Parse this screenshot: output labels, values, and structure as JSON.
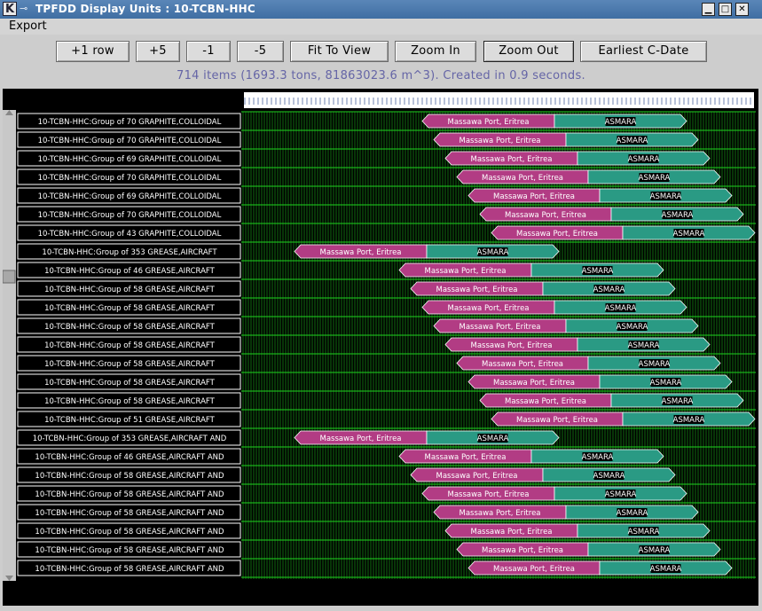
{
  "window": {
    "title": "TPFDD Display Units : 10-TCBN-HHC"
  },
  "menu": {
    "export": "Export"
  },
  "toolbar": {
    "plus_one_row": "+1 row",
    "plus_five": "+5",
    "minus_one": "-1",
    "minus_five": "-5",
    "fit_to_view": "Fit To View",
    "zoom_in": "Zoom In",
    "zoom_out": "Zoom Out",
    "earliest_cdate": "Earliest C-Date"
  },
  "status_text": "714 items (1693.3 tons, 81863023.6 m^3). Created in 0.9 seconds.",
  "colors": {
    "grid": "#1fd21f",
    "origin_segment": "#b23c84",
    "destination_segment": "#2a9a84",
    "label_bg": "#000000",
    "status_text": "#6565a6"
  },
  "chart_data": {
    "type": "gantt",
    "rows": [
      {
        "label": "10-TCBN-HHC:Group of 70 GRAPHITE,COLLOIDAL",
        "origin": "Massawa Port, Eritrea",
        "destination": "ASMARA",
        "start": 476,
        "split": 625,
        "end": 774
      },
      {
        "label": "10-TCBN-HHC:Group of 70 GRAPHITE,COLLOIDAL",
        "origin": "Massawa Port, Eritrea",
        "destination": "ASMARA",
        "start": 489,
        "split": 638,
        "end": 787
      },
      {
        "label": "10-TCBN-HHC:Group of 69 GRAPHITE,COLLOIDAL",
        "origin": "Massawa Port, Eritrea",
        "destination": "ASMARA",
        "start": 502,
        "split": 651,
        "end": 800
      },
      {
        "label": "10-TCBN-HHC:Group of 70 GRAPHITE,COLLOIDAL",
        "origin": "Massawa Port, Eritrea",
        "destination": "ASMARA",
        "start": 515,
        "split": 663,
        "end": 812
      },
      {
        "label": "10-TCBN-HHC:Group of 69 GRAPHITE,COLLOIDAL",
        "origin": "Massawa Port, Eritrea",
        "destination": "ASMARA",
        "start": 528,
        "split": 676,
        "end": 825
      },
      {
        "label": "10-TCBN-HHC:Group of 70 GRAPHITE,COLLOIDAL",
        "origin": "Massawa Port, Eritrea",
        "destination": "ASMARA",
        "start": 541,
        "split": 689,
        "end": 838
      },
      {
        "label": "10-TCBN-HHC:Group of 43 GRAPHITE,COLLOIDAL",
        "origin": "Massawa Port, Eritrea",
        "destination": "ASMARA",
        "start": 554,
        "split": 702,
        "end": 851
      },
      {
        "label": "10-TCBN-HHC:Group of 353 GREASE,AIRCRAFT",
        "origin": "Massawa Port, Eritrea",
        "destination": "ASMARA",
        "start": 332,
        "split": 481,
        "end": 630
      },
      {
        "label": "10-TCBN-HHC:Group of 46 GREASE,AIRCRAFT",
        "origin": "Massawa Port, Eritrea",
        "destination": "ASMARA",
        "start": 450,
        "split": 599,
        "end": 748
      },
      {
        "label": "10-TCBN-HHC:Group of 58 GREASE,AIRCRAFT",
        "origin": "Massawa Port, Eritrea",
        "destination": "ASMARA",
        "start": 463,
        "split": 612,
        "end": 761
      },
      {
        "label": "10-TCBN-HHC:Group of 58 GREASE,AIRCRAFT",
        "origin": "Massawa Port, Eritrea",
        "destination": "ASMARA",
        "start": 476,
        "split": 625,
        "end": 774
      },
      {
        "label": "10-TCBN-HHC:Group of 58 GREASE,AIRCRAFT",
        "origin": "Massawa Port, Eritrea",
        "destination": "ASMARA",
        "start": 489,
        "split": 638,
        "end": 787
      },
      {
        "label": "10-TCBN-HHC:Group of 58 GREASE,AIRCRAFT",
        "origin": "Massawa Port, Eritrea",
        "destination": "ASMARA",
        "start": 502,
        "split": 651,
        "end": 800
      },
      {
        "label": "10-TCBN-HHC:Group of 58 GREASE,AIRCRAFT",
        "origin": "Massawa Port, Eritrea",
        "destination": "ASMARA",
        "start": 515,
        "split": 663,
        "end": 812
      },
      {
        "label": "10-TCBN-HHC:Group of 58 GREASE,AIRCRAFT",
        "origin": "Massawa Port, Eritrea",
        "destination": "ASMARA",
        "start": 528,
        "split": 676,
        "end": 825
      },
      {
        "label": "10-TCBN-HHC:Group of 58 GREASE,AIRCRAFT",
        "origin": "Massawa Port, Eritrea",
        "destination": "ASMARA",
        "start": 541,
        "split": 689,
        "end": 838
      },
      {
        "label": "10-TCBN-HHC:Group of 51 GREASE,AIRCRAFT",
        "origin": "Massawa Port, Eritrea",
        "destination": "ASMARA",
        "start": 554,
        "split": 702,
        "end": 851
      },
      {
        "label": "10-TCBN-HHC:Group of 353 GREASE,AIRCRAFT AND",
        "origin": "Massawa Port, Eritrea",
        "destination": "ASMARA",
        "start": 332,
        "split": 481,
        "end": 630
      },
      {
        "label": "10-TCBN-HHC:Group of 46 GREASE,AIRCRAFT AND",
        "origin": "Massawa Port, Eritrea",
        "destination": "ASMARA",
        "start": 450,
        "split": 599,
        "end": 748
      },
      {
        "label": "10-TCBN-HHC:Group of 58 GREASE,AIRCRAFT AND",
        "origin": "Massawa Port, Eritrea",
        "destination": "ASMARA",
        "start": 463,
        "split": 612,
        "end": 761
      },
      {
        "label": "10-TCBN-HHC:Group of 58 GREASE,AIRCRAFT AND",
        "origin": "Massawa Port, Eritrea",
        "destination": "ASMARA",
        "start": 476,
        "split": 625,
        "end": 774
      },
      {
        "label": "10-TCBN-HHC:Group of 58 GREASE,AIRCRAFT AND",
        "origin": "Massawa Port, Eritrea",
        "destination": "ASMARA",
        "start": 489,
        "split": 638,
        "end": 787
      },
      {
        "label": "10-TCBN-HHC:Group of 58 GREASE,AIRCRAFT AND",
        "origin": "Massawa Port, Eritrea",
        "destination": "ASMARA",
        "start": 502,
        "split": 651,
        "end": 800
      },
      {
        "label": "10-TCBN-HHC:Group of 58 GREASE,AIRCRAFT AND",
        "origin": "Massawa Port, Eritrea",
        "destination": "ASMARA",
        "start": 515,
        "split": 663,
        "end": 812
      },
      {
        "label": "10-TCBN-HHC:Group of 58 GREASE,AIRCRAFT AND",
        "origin": "Massawa Port, Eritrea",
        "destination": "ASMARA",
        "start": 528,
        "split": 676,
        "end": 825
      }
    ]
  }
}
